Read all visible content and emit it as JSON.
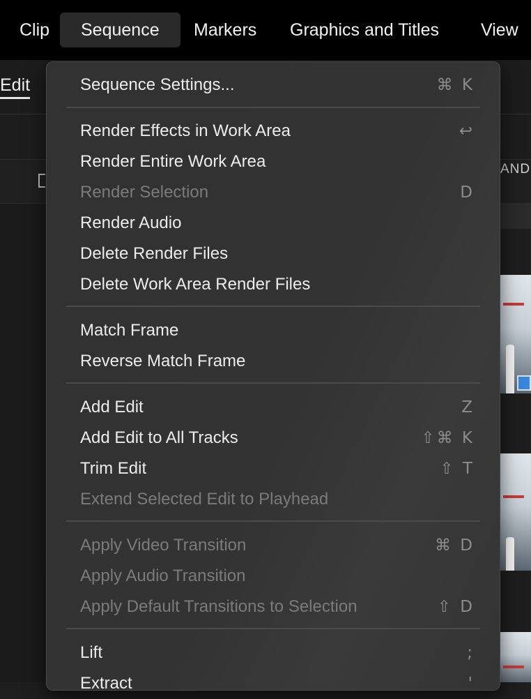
{
  "menubar": {
    "items": [
      {
        "label": "Clip"
      },
      {
        "label": "Sequence"
      },
      {
        "label": "Markers"
      },
      {
        "label": "Graphics and Titles"
      },
      {
        "label": "View"
      }
    ]
  },
  "background": {
    "edit_tab": "Edit",
    "column_header": "AND"
  },
  "menu": {
    "items": [
      {
        "label": "Sequence Settings...",
        "shortcut": "⌘ K",
        "enabled": true
      },
      {
        "label": "Render Effects in Work Area",
        "shortcut": "↩",
        "enabled": true
      },
      {
        "label": "Render Entire Work Area",
        "shortcut": "",
        "enabled": true
      },
      {
        "label": "Render Selection",
        "shortcut": "D",
        "enabled": false
      },
      {
        "label": "Render Audio",
        "shortcut": "",
        "enabled": true
      },
      {
        "label": "Delete Render Files",
        "shortcut": "",
        "enabled": true
      },
      {
        "label": "Delete Work Area Render Files",
        "shortcut": "",
        "enabled": true
      },
      {
        "label": "Match Frame",
        "shortcut": "",
        "enabled": true
      },
      {
        "label": "Reverse Match Frame",
        "shortcut": "",
        "enabled": true
      },
      {
        "label": "Add Edit",
        "shortcut": "Z",
        "enabled": true
      },
      {
        "label": "Add Edit to All Tracks",
        "shortcut": "⇧⌘ K",
        "enabled": true
      },
      {
        "label": "Trim Edit",
        "shortcut": "⇧ T",
        "enabled": true
      },
      {
        "label": "Extend Selected Edit to Playhead",
        "shortcut": "",
        "enabled": false
      },
      {
        "label": "Apply Video Transition",
        "shortcut": "⌘ D",
        "enabled": false
      },
      {
        "label": "Apply Audio Transition",
        "shortcut": "",
        "enabled": false
      },
      {
        "label": "Apply Default Transitions to Selection",
        "shortcut": "⇧ D",
        "enabled": false
      },
      {
        "label": "Lift",
        "shortcut": ";",
        "enabled": true
      },
      {
        "label": "Extract",
        "shortcut": "'",
        "enabled": true
      }
    ]
  }
}
